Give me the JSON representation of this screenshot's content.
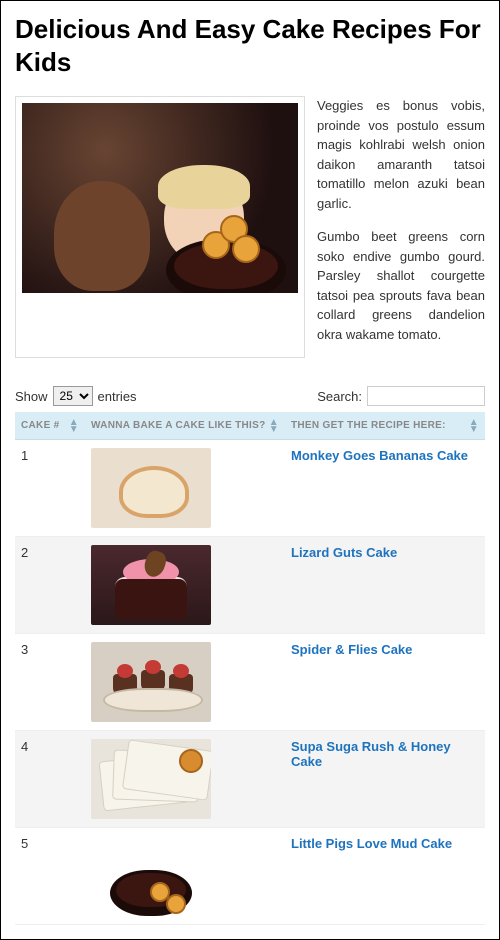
{
  "title": "Delicious And Easy Cake Recipes For Kids",
  "intro": {
    "p1": "Veggies es bonus vobis, proinde vos postulo essum magis kohlrabi welsh onion daikon amaranth tatsoi tomatillo melon azuki bean garlic.",
    "p2": "Gumbo beet greens corn soko endive gumbo gourd. Parsley shallot courgette tatsoi pea sprouts fava bean collard greens dandelion okra wakame tomato."
  },
  "controls": {
    "show_prefix": "Show",
    "show_suffix": "entries",
    "page_size": "25",
    "search_label": "Search:"
  },
  "columns": {
    "col1": "Cake #",
    "col2": "Wanna Bake A Cake Like This?",
    "col3": "Then Get The Recipe Here:"
  },
  "rows": [
    {
      "num": "1",
      "recipe": "Monkey Goes Bananas Cake",
      "thumb": "th1"
    },
    {
      "num": "2",
      "recipe": "Lizard Guts Cake",
      "thumb": "th2"
    },
    {
      "num": "3",
      "recipe": "Spider & Flies Cake",
      "thumb": "th3"
    },
    {
      "num": "4",
      "recipe": "Supa Suga Rush & Honey Cake",
      "thumb": "th4"
    },
    {
      "num": "5",
      "recipe": "Little Pigs Love Mud Cake",
      "thumb": "th5"
    }
  ]
}
